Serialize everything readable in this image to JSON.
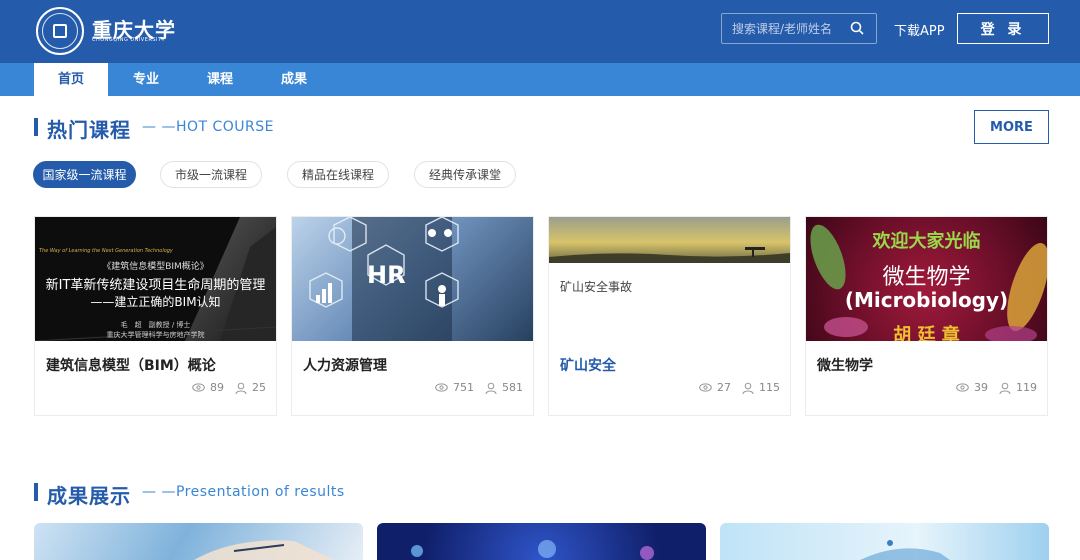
{
  "header": {
    "brand_cn": "重庆大学",
    "brand_en": "CHONGQING UNIVERSITY",
    "search_placeholder": "搜索课程/老师姓名",
    "download_label": "下载APP",
    "login_label": "登 录"
  },
  "nav": {
    "items": [
      {
        "label": "首页",
        "active": true
      },
      {
        "label": "专业",
        "active": false
      },
      {
        "label": "课程",
        "active": false
      },
      {
        "label": "成果",
        "active": false
      }
    ]
  },
  "hot_course": {
    "title": "热门课程",
    "subtitle": "— —HOT COURSE",
    "more_label": "MORE",
    "filters": [
      {
        "label": "国家级一流课程",
        "active": true
      },
      {
        "label": "市级一流课程",
        "active": false
      },
      {
        "label": "精品在线课程",
        "active": false
      },
      {
        "label": "经典传承课堂",
        "active": false
      }
    ],
    "courses": [
      {
        "title": "建筑信息模型（BIM）概论",
        "views": "89",
        "students": "25",
        "thumb": {
          "tagline": "The Way of Learning the Next Generation Technology",
          "line1": "《建筑信息模型BIM概论》",
          "line2": "新IT革新传统建设项目生命周期的管理",
          "line3": "——建立正确的BIM认知",
          "teacher": "毛　超　副教授 / 博士",
          "college": "重庆大学管理科学与房地产学院"
        }
      },
      {
        "title": "人力资源管理",
        "views": "751",
        "students": "581",
        "thumb": {
          "hr_text": "HR"
        }
      },
      {
        "title": "矿山安全",
        "views": "27",
        "students": "115",
        "thumb": {
          "caption": "矿山安全事故"
        }
      },
      {
        "title": "微生物学",
        "views": "39",
        "students": "119",
        "thumb": {
          "welcome": "欢迎大家光临",
          "subject_cn": "微生物学",
          "subject_en": "(Microbiology)",
          "teacher": "胡 廷 章"
        }
      }
    ]
  },
  "results": {
    "title": "成果展示",
    "subtitle": "— —Presentation of results"
  },
  "colors": {
    "primary": "#245bab",
    "nav": "#3a86d6"
  }
}
